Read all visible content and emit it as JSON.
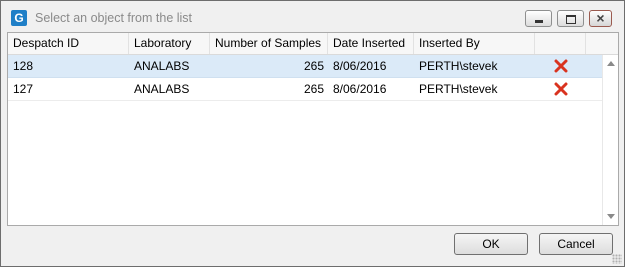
{
  "window": {
    "title": "Select an object from the list",
    "app_icon_letter": "G"
  },
  "grid": {
    "columns": [
      "Despatch ID",
      "Laboratory",
      "Number of Samples",
      "Date Inserted",
      "Inserted By"
    ],
    "rows": [
      {
        "despatch_id": "128",
        "laboratory": "ANALABS",
        "samples": "265",
        "date": "8/06/2016",
        "inserted_by": "PERTH\\stevek",
        "selected": true
      },
      {
        "despatch_id": "127",
        "laboratory": "ANALABS",
        "samples": "265",
        "date": "8/06/2016",
        "inserted_by": "PERTH\\stevek",
        "selected": false
      }
    ],
    "delete_icon": "red-x-icon"
  },
  "buttons": {
    "ok_label": "OK",
    "cancel_label": "Cancel"
  },
  "colors": {
    "selected_row": "#dbeaf8",
    "delete_icon": "#d9331f",
    "app_icon": "#1f7fc7"
  }
}
